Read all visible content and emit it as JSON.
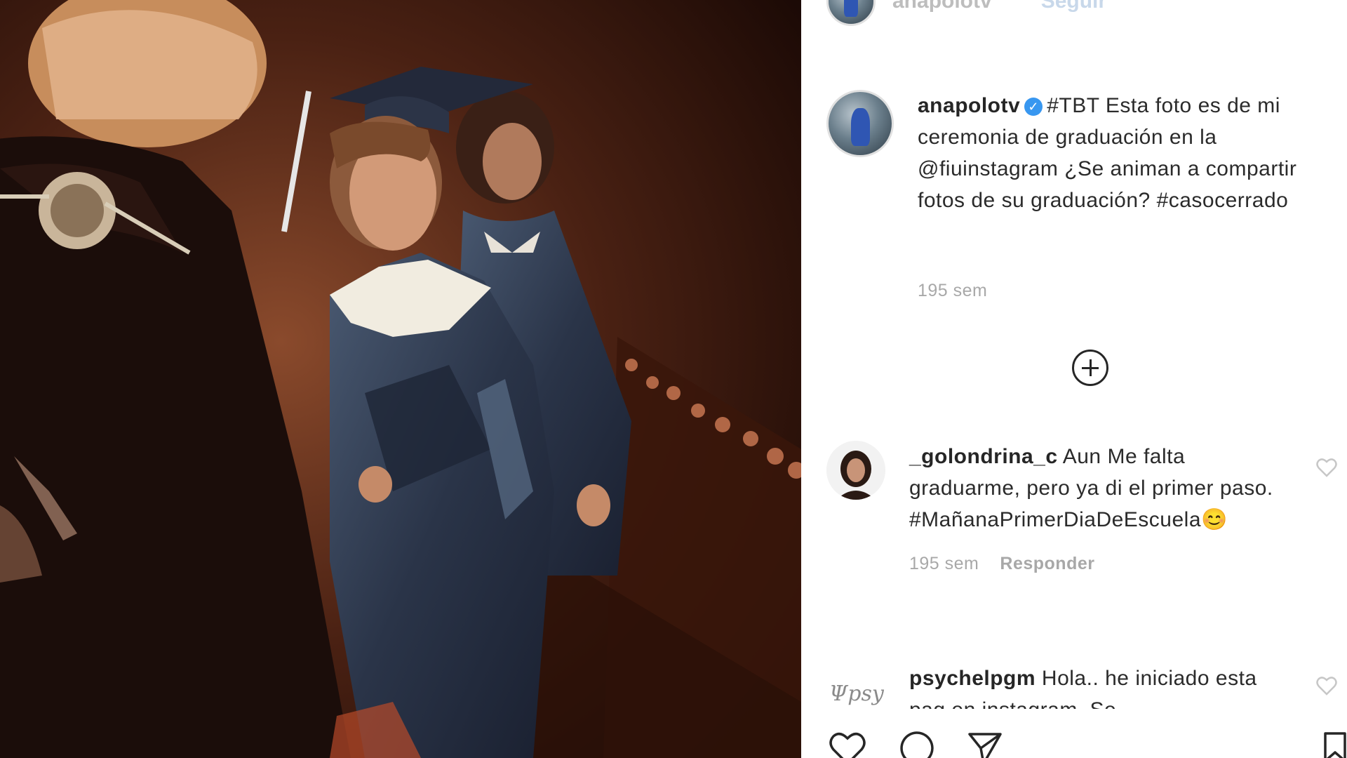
{
  "post": {
    "header_username": "anapolotv",
    "header_follow": "Seguir",
    "image_alt": "graduation-photo"
  },
  "caption": {
    "username": "anapolotv",
    "text": "#TBT Esta foto es de mi ceremonia de graduación en la @fiuinstagram ¿Se animan a compartir fotos de su graduación? #casocerrado",
    "time": "195 sem"
  },
  "comments": [
    {
      "username": "_golondrina_c",
      "text": "Aun Me falta graduarme, pero ya di el primer paso. #MañanaPrimerDiaDeEscuela😊",
      "time": "195 sem",
      "reply_label": "Responder"
    },
    {
      "username": "psychelpgm",
      "text": "Hola.. he iniciado esta pag en instagram. Se",
      "time": "",
      "reply_label": ""
    }
  ],
  "icons": {
    "verified": "verified-badge-icon",
    "load_more": "plus-circle-icon",
    "like": "heart-icon",
    "comment": "comment-icon",
    "share": "paper-plane-icon",
    "save": "bookmark-icon"
  },
  "colors": {
    "verified_blue": "#3897f0",
    "muted_text": "#a8a8a8",
    "text": "#262626"
  }
}
